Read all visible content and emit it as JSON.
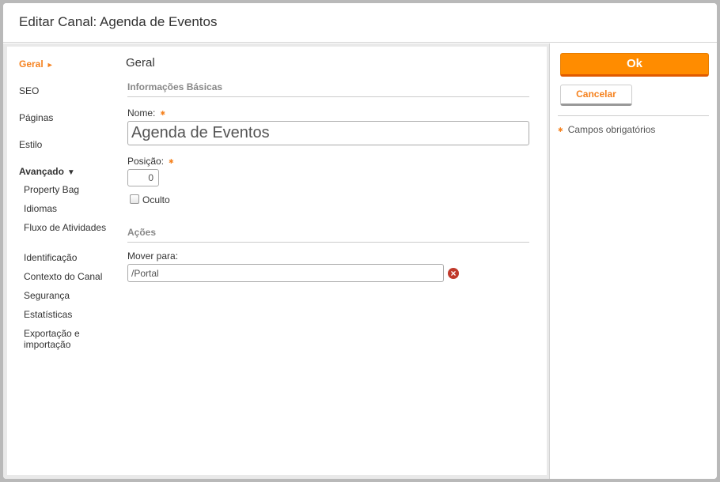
{
  "dialog": {
    "title": "Editar Canal: Agenda de Eventos"
  },
  "nav": {
    "geral": "Geral",
    "seo": "SEO",
    "paginas": "Páginas",
    "estilo": "Estilo",
    "avancado": "Avançado",
    "sub": [
      "Property Bag",
      "Idiomas",
      "Fluxo de Atividades",
      "Identificação",
      "Contexto do Canal",
      "Segurança",
      "Estatísticas",
      "Exportação e importação"
    ]
  },
  "main": {
    "section_title": "Geral",
    "basic_info": "Informações Básicas",
    "name_label": "Nome:",
    "name_value": "Agenda de Eventos",
    "position_label": "Posição:",
    "position_value": "0",
    "hidden_label": "Oculto",
    "actions_title": "Ações",
    "move_label": "Mover para:",
    "move_value": "/Portal"
  },
  "actions": {
    "ok": "Ok",
    "cancel": "Cancelar",
    "required_note": "Campos obrigatórios"
  },
  "colors": {
    "accent": "#f5821f",
    "ok_button": "#ff8c00",
    "clear": "#c0392b"
  },
  "icons": {
    "required": "asterisk-icon",
    "clear": "clear-icon",
    "active_arrow": "arrow-right-icon",
    "group_caret": "caret-down-icon"
  }
}
